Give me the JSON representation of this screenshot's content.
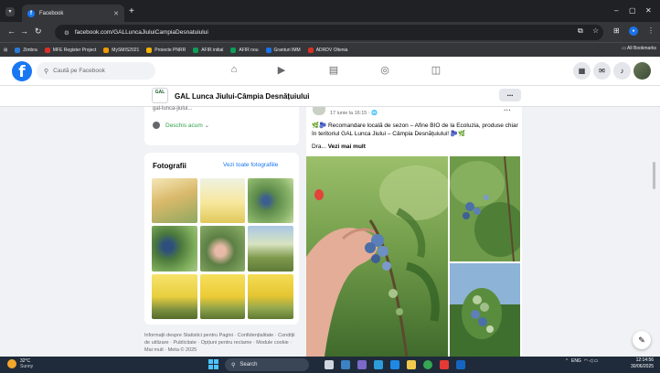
{
  "browser": {
    "tab_title": "Facebook",
    "tab_favicon": "facebook-favicon",
    "url": "facebook.com/GALLuncaJiuluiCampiaDesnatuiului",
    "bookmarks": [
      {
        "label": "Zimbra",
        "color": "#2b7bd6"
      },
      {
        "label": "MFE Register Project",
        "color": "#d93025"
      },
      {
        "label": "MySMIS2021",
        "color": "#f29900"
      },
      {
        "label": "Proiecte PNRR",
        "color": "#f4b400"
      },
      {
        "label": "AFIR initial",
        "color": "#0f9d58"
      },
      {
        "label": "AFIR nou",
        "color": "#0f9d58"
      },
      {
        "label": "Granturi IMM",
        "color": "#1a73e8"
      },
      {
        "label": "ADRDV Oltenia",
        "color": "#d93025"
      }
    ],
    "all_bookmarks": "All Bookmarks"
  },
  "facebook": {
    "search_placeholder": "Caută pe Facebook",
    "brand_color": "#1877f2",
    "nav_icons": [
      "home-icon",
      "video-icon",
      "marketplace-icon",
      "groups-icon",
      "gaming-icon"
    ],
    "right_icons": [
      "menu-grid-icon",
      "messenger-icon",
      "notifications-icon"
    ]
  },
  "page": {
    "logo_text": "GAL",
    "name": "GAL Lunca Jiului-Câmpia Desnățuiului",
    "more_label": "...",
    "intro_partial": "gal-lunca-jiului...",
    "open_now": "Deschis acum",
    "open_now_chevron": "⌄",
    "photos_title": "Fotografii",
    "photos_link": "Vezi toate fotografiile",
    "footer": "Informații despre Statistici pentru Pagini · Confidențialitate · Condiții de utilizare · Publicitate · Opțiuni pentru reclame · Module cookie · Mai mult · Meta © 2025"
  },
  "post": {
    "timestamp": "17 iunie la 16:15 · 🌐",
    "text": "🌿🫐 Recomandare locală de sezon – Afine BIO de la Ecoluzia, produse chiar în teritoriul GAL Lunca Jiului – Câmpia Desnățuiului! 🫐🌿",
    "more_prefix": "Dra... ",
    "more_link": "Vezi mai mult"
  },
  "taskbar": {
    "temperature": "32°C",
    "weather_desc": "Sunny",
    "search_label": "Search",
    "language": "ENG",
    "time": "12:14:56",
    "date": "30/06/2025"
  }
}
